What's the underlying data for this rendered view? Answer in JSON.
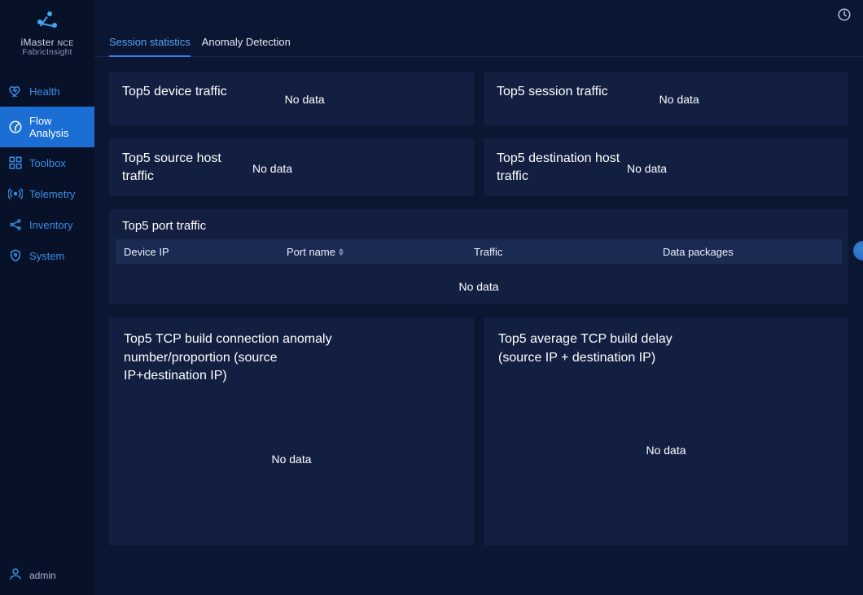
{
  "brand": {
    "main": "iMaster",
    "nce": "NCE",
    "sub": "FabricInsight"
  },
  "sidebar": {
    "items": [
      {
        "label": "Health",
        "icon": "heart-icon"
      },
      {
        "label": "Flow Analysis",
        "icon": "radar-icon"
      },
      {
        "label": "Toolbox",
        "icon": "grid-icon"
      },
      {
        "label": "Telemetry",
        "icon": "signal-icon"
      },
      {
        "label": "Inventory",
        "icon": "share-icon"
      },
      {
        "label": "System",
        "icon": "shield-icon"
      }
    ],
    "active_index": 1
  },
  "footer_user": "admin",
  "tabs": {
    "items": [
      {
        "label": "Session statistics"
      },
      {
        "label": "Anomaly Detection"
      }
    ],
    "active_index": 0
  },
  "cards": {
    "device_traffic": {
      "title": "Top5 device traffic",
      "nodata": "No data"
    },
    "session_traffic": {
      "title": "Top5 session traffic",
      "nodata": "No data"
    },
    "source_host": {
      "title": "Top5 source host traffic",
      "nodata": "No data"
    },
    "dest_host": {
      "title": "Top5 destination host traffic",
      "nodata": "No data"
    },
    "port_traffic": {
      "title": "Top5 port traffic",
      "columns": {
        "device_ip": "Device IP",
        "port_name": "Port name",
        "traffic": "Traffic",
        "data_packages": "Data packages"
      },
      "nodata": "No data"
    },
    "tcp_anomaly": {
      "title": "Top5 TCP build connection anomaly number/proportion (source IP+destination IP)",
      "nodata": "No data"
    },
    "tcp_delay": {
      "title": "Top5 average TCP build delay (source IP + destination IP)",
      "nodata": "No data"
    }
  }
}
